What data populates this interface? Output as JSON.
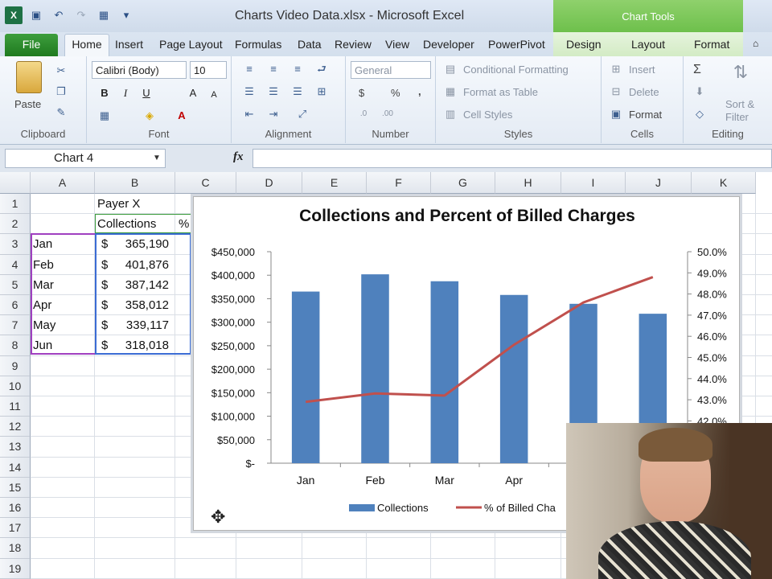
{
  "window": {
    "title": "Charts Video Data.xlsx - Microsoft Excel",
    "contextual_tab_group": "Chart Tools"
  },
  "tabs": [
    "File",
    "Home",
    "Insert",
    "Page Layout",
    "Formulas",
    "Data",
    "Review",
    "View",
    "Developer",
    "PowerPivot",
    "Design",
    "Layout",
    "Format"
  ],
  "ribbon": {
    "clipboard": {
      "paste": "Paste",
      "label": "Clipboard"
    },
    "font": {
      "name": "Calibri (Body)",
      "size": "10",
      "label": "Font"
    },
    "alignment": {
      "label": "Alignment"
    },
    "number": {
      "format": "General",
      "currency": "$",
      "percent": "%",
      "comma": ",",
      "label": "Number"
    },
    "styles": {
      "conditional": "Conditional Formatting",
      "format_table": "Format as Table",
      "cell_styles": "Cell Styles",
      "label": "Styles"
    },
    "cells": {
      "insert": "Insert",
      "delete": "Delete",
      "format": "Format",
      "label": "Cells"
    },
    "editing": {
      "sigma": "Σ",
      "sort": "Sort &",
      "filter": "Filter",
      "label": "Editing"
    }
  },
  "formula_bar": {
    "name_box": "Chart 4",
    "fx": "fx",
    "value": ""
  },
  "columns": [
    "A",
    "B",
    "C",
    "D",
    "E",
    "F",
    "G",
    "H",
    "I",
    "J",
    "K"
  ],
  "rows": [
    "1",
    "2",
    "3",
    "4",
    "5",
    "6",
    "7",
    "8",
    "9",
    "10",
    "11",
    "12",
    "13",
    "14",
    "15",
    "16",
    "17",
    "18",
    "19"
  ],
  "sheet": {
    "b1": "Payer X",
    "b2": "Collections",
    "c2": "%",
    "months": [
      "Jan",
      "Feb",
      "Mar",
      "Apr",
      "May",
      "Jun"
    ],
    "currency_symbol": "$",
    "collections": [
      "365,190",
      "401,876",
      "387,142",
      "358,012",
      "339,117",
      "318,018"
    ]
  },
  "chart_data": {
    "type": "bar",
    "title": "Collections and Percent of Billed Charges",
    "categories": [
      "Jan",
      "Feb",
      "Mar",
      "Apr",
      "May",
      "Jun"
    ],
    "visible_category_labels": [
      "Jan",
      "Feb",
      "Mar",
      "Apr"
    ],
    "series": [
      {
        "name": "Collections",
        "type": "bar",
        "axis": "left",
        "values": [
          365190,
          401876,
          387142,
          358012,
          339117,
          318018
        ],
        "color": "#4f81bd"
      },
      {
        "name": "% of Billed Charges",
        "type": "line",
        "axis": "right",
        "values": [
          42.9,
          43.3,
          43.2,
          45.6,
          47.6,
          48.8
        ],
        "color": "#c0504d"
      }
    ],
    "y_left": {
      "min": 0,
      "max": 450000,
      "step": 50000,
      "ticks": [
        "$-",
        "$50,000",
        "$100,000",
        "$150,000",
        "$200,000",
        "$250,000",
        "$300,000",
        "$350,000",
        "$400,000",
        "$450,000"
      ]
    },
    "y_right": {
      "min": 40,
      "max": 50,
      "step": 1,
      "ticks": [
        "42.0%",
        "43.0%",
        "44.0%",
        "45.0%",
        "46.0%",
        "47.0%",
        "48.0%",
        "49.0%",
        "50.0%"
      ]
    },
    "legend_labels": [
      "Collections",
      "% of Billed Cha"
    ],
    "legend": "bottom",
    "grid": false
  },
  "webcam": {
    "description": "presenter"
  }
}
